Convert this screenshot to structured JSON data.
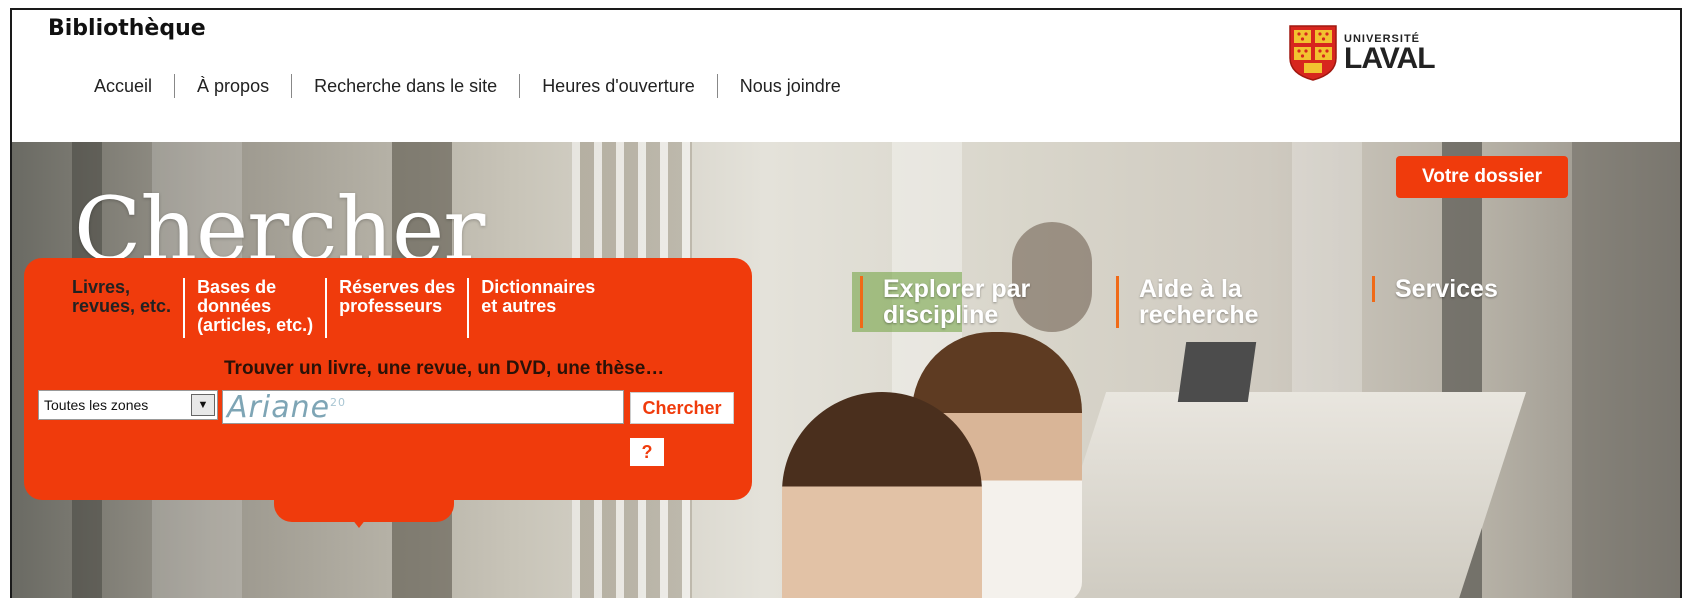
{
  "header": {
    "brand": "Bibliothèque",
    "nav": [
      "Accueil",
      "À propos",
      "Recherche dans le site",
      "Heures d'ouverture",
      "Nous joindre"
    ],
    "logo": {
      "small": "UNIVERSITÉ",
      "big": "LAVAL",
      "icon": "crest-icon"
    }
  },
  "hero": {
    "title": "Chercher",
    "account_button": "Votre dossier",
    "sections": [
      "Explorer par\ndiscipline",
      "Aide à la\nrecherche",
      "Services"
    ]
  },
  "search_panel": {
    "tabs": [
      "Livres,\nrevues, etc.",
      "Bases de\ndonnées\n(articles, etc.)",
      "Réserves des\nprofesseurs",
      "Dictionnaires\net autres"
    ],
    "active_tab": 0,
    "prompt": "Trouver un livre, une revue, un DVD, une thèse…",
    "zone_select": "Toutes les zones",
    "search_logo": "Ariane",
    "search_logo_sup": "20",
    "search_button": "Chercher",
    "help_button": "?"
  },
  "colors": {
    "accent": "#f03b0c",
    "section_border": "#f06a17"
  }
}
